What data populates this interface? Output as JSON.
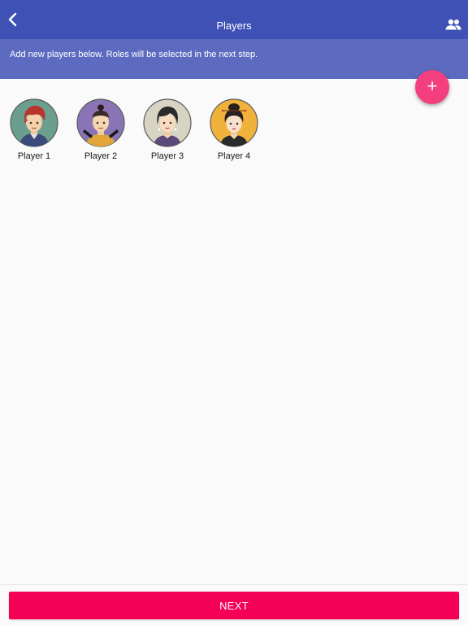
{
  "header": {
    "title": "Players",
    "back_icon": "chevron-left-icon",
    "action_icon": "people-icon",
    "color": "#3f51b5"
  },
  "banner": {
    "text": "Add new players below. Roles will be selected in the next step.",
    "color": "#5c6bc0"
  },
  "fab": {
    "label": "+",
    "icon": "add-icon",
    "color": "#f43f7f"
  },
  "players": [
    {
      "name": "Player 1",
      "avatar": "red-haired-boy-avatar",
      "bg": "#6b9e8e"
    },
    {
      "name": "Player 2",
      "avatar": "topknot-warrior-avatar",
      "bg": "#8a74b6"
    },
    {
      "name": "Player 3",
      "avatar": "dark-haired-woman-avatar",
      "bg": "#d8d4c4"
    },
    {
      "name": "Player 4",
      "avatar": "geisha-woman-avatar",
      "bg": "#f0b23a"
    }
  ],
  "footer": {
    "next_label": "NEXT",
    "color": "#f50057"
  }
}
